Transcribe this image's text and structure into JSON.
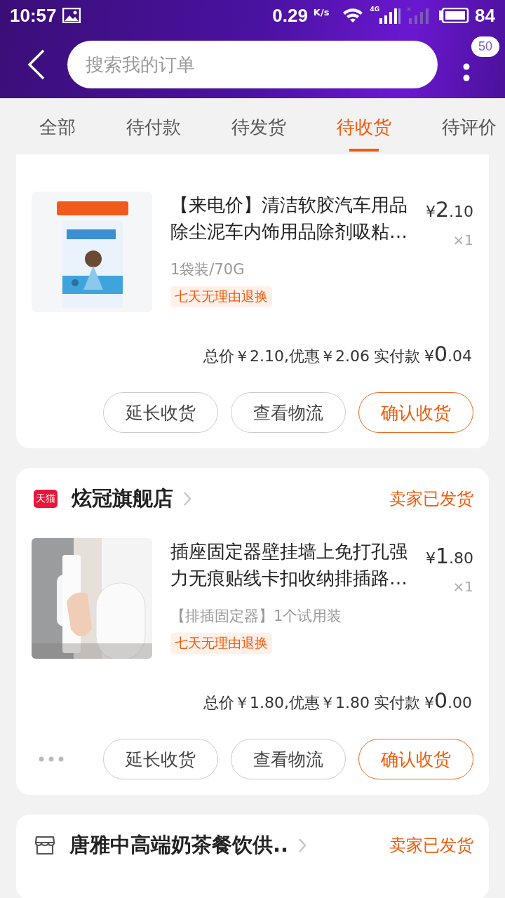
{
  "status_bar": {
    "time": "10:57",
    "speed": "0.29",
    "speed_unit": "K/s",
    "network": "4G",
    "battery": "84"
  },
  "header": {
    "search": {
      "placeholder": "搜索我的订单"
    },
    "message_badge": "50"
  },
  "tabs": [
    {
      "label": "全部",
      "selected": false
    },
    {
      "label": "待付款",
      "selected": false
    },
    {
      "label": "待发货",
      "selected": false
    },
    {
      "label": "待收货",
      "selected": true
    },
    {
      "label": "待评价",
      "selected": false
    }
  ],
  "orders": [
    {
      "items": [
        {
          "title": "【来电价】清洁软胶汽车用品除尘泥车内饰用品除剂吸粘…",
          "currency": "¥",
          "price_int": "2",
          "price_dec": ".10",
          "quantity": "×1",
          "spec": "1袋装/70G",
          "tag": "七天无理由退换",
          "kind": "picture"
        }
      ],
      "summary": "总价￥2.10,优惠￥2.06",
      "paid_label": "实付款",
      "paid_currency": "¥",
      "paid_int": "0",
      "paid_dec": ".04",
      "more": false,
      "buttons": [
        {
          "label": "延长收货",
          "kind": "outline"
        },
        {
          "label": "查看物流",
          "kind": "outline"
        },
        {
          "label": "确认收货",
          "kind": "primary"
        }
      ]
    },
    {
      "store": {
        "kind": "tmall",
        "badge": "天猫",
        "name": "炫冠旗舰店",
        "status": "卖家已发货"
      },
      "items": [
        {
          "title": "插座固定器壁挂墙上免打孔强力无痕贴线卡扣收纳排插路…",
          "currency": "¥",
          "price_int": "1",
          "price_dec": ".80",
          "quantity": "×1",
          "spec": "【排插固定器】1个试用装",
          "tag": "七天无理由退换",
          "kind": "picture"
        }
      ],
      "summary": "总价￥1.80,优惠￥1.80",
      "paid_label": "实付款",
      "paid_currency": "¥",
      "paid_int": "0",
      "paid_dec": ".00",
      "more": true,
      "buttons": [
        {
          "label": "延长收货",
          "kind": "outline"
        },
        {
          "label": "查看物流",
          "kind": "outline"
        },
        {
          "label": "确认收货",
          "kind": "primary"
        }
      ]
    },
    {
      "store": {
        "kind": "shop",
        "name": "唐雅中高端奶茶餐饮供..",
        "status": "卖家已发货"
      }
    }
  ]
}
